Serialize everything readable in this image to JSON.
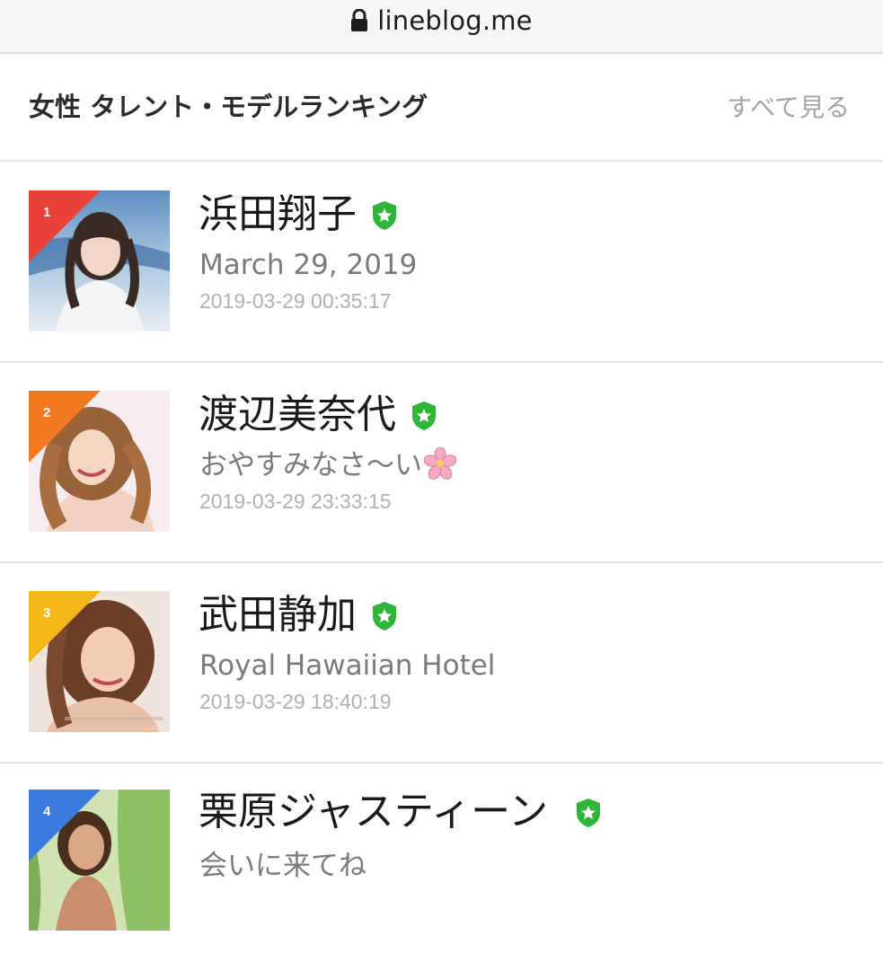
{
  "browser": {
    "url": "lineblog.me",
    "lock_icon": "lock-icon"
  },
  "section": {
    "title": "女性 タレント・モデルランキング",
    "see_all": "すべて見る"
  },
  "colors": {
    "rank1": "#e8413a",
    "rank2": "#f47a1f",
    "rank3": "#f5b81a",
    "rank4": "#3d7be0",
    "badge": "#2fb537"
  },
  "rankings": [
    {
      "rank": "1",
      "name": "浜田翔子",
      "badge_icon": "verified-shield-star-icon",
      "title": "March 29, 2019",
      "date": "2019-03-29 00:35:17"
    },
    {
      "rank": "2",
      "name": "渡辺美奈代",
      "badge_icon": "verified-shield-star-icon",
      "title": "おやすみなさ〜い",
      "title_emoji": "cherry-blossom-icon",
      "date": "2019-03-29 23:33:15"
    },
    {
      "rank": "3",
      "name": "武田静加",
      "badge_icon": "verified-shield-star-icon",
      "title": "Royal Hawaiian Hotel",
      "date": "2019-03-29 18:40:19"
    },
    {
      "rank": "4",
      "name": "栗原ジャスティーン",
      "badge_icon": "verified-shield-star-icon",
      "title": "会いに来てね",
      "date": ""
    }
  ]
}
